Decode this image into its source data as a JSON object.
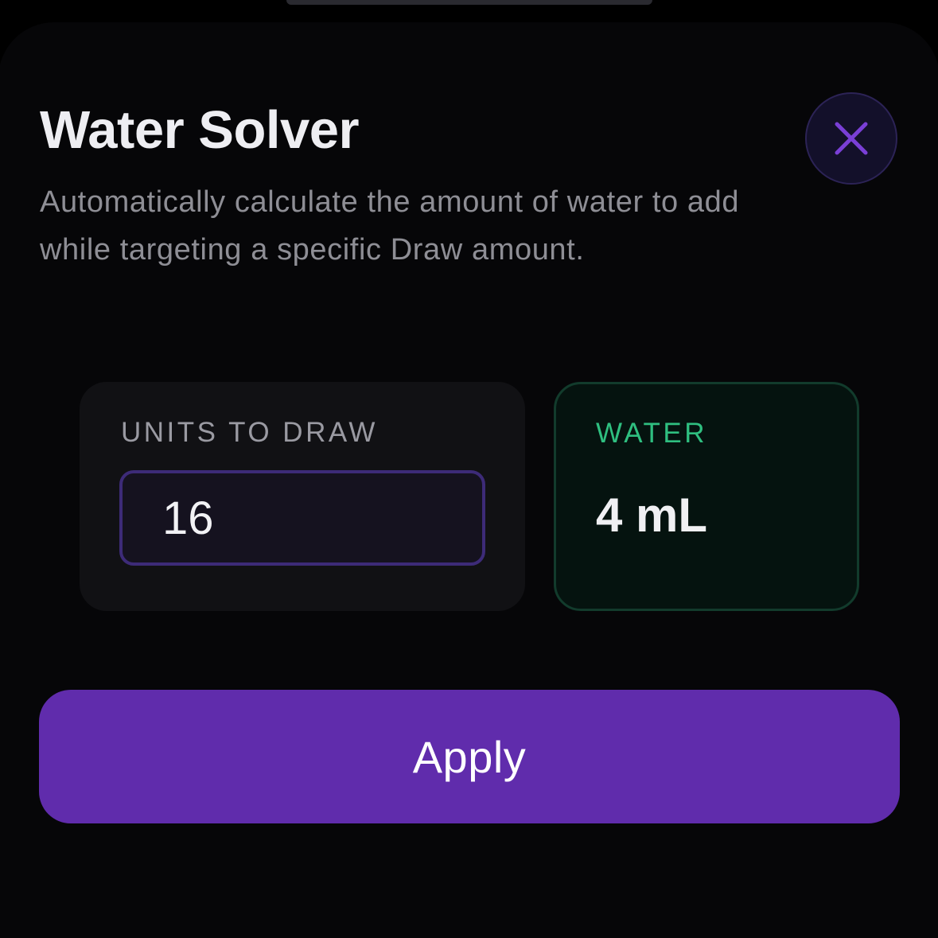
{
  "header": {
    "title": "Water Solver",
    "subtitle": "Automatically calculate the amount of water to add while targeting a specific Draw amount.",
    "close_icon": "close-icon"
  },
  "units_card": {
    "label": "UNITS TO DRAW",
    "input_value": "16"
  },
  "water_card": {
    "label": "WATER",
    "value": "4 mL"
  },
  "actions": {
    "apply_label": "Apply"
  },
  "colors": {
    "accent": "#602cac",
    "water_green": "#2fbf80",
    "close_x": "#7a3fd6",
    "background": "#060608"
  }
}
